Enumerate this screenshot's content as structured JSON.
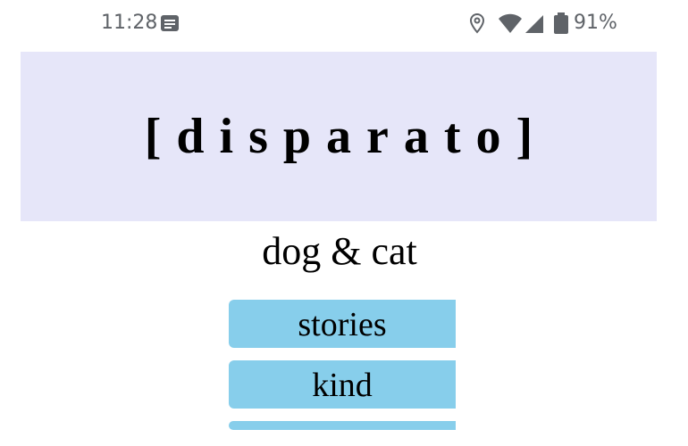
{
  "status_bar": {
    "time": "11:28",
    "battery": "91%",
    "icons": [
      "notification-icon",
      "location-icon",
      "wifi-icon",
      "signal-icon",
      "battery-icon"
    ]
  },
  "banner": {
    "title": "[disparato]",
    "background": "#e6e6f9"
  },
  "subtitle": "dog & cat",
  "menu": {
    "color": "#87ceeb",
    "items": [
      {
        "label": "stories"
      },
      {
        "label": "kind"
      }
    ]
  }
}
